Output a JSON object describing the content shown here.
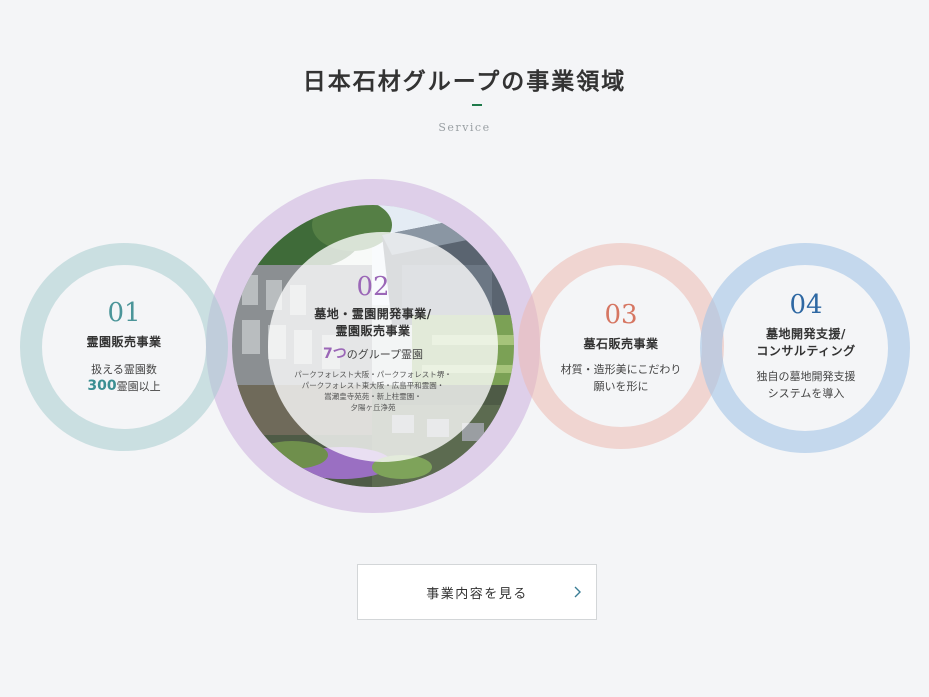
{
  "header": {
    "title": "日本石材グループの事業領域",
    "subtitle": "Service"
  },
  "services": [
    {
      "num": "01",
      "heading_lines": [
        "霊園販売事業"
      ],
      "desc_lines": [
        "扱える霊園数"
      ],
      "highlight_value": "300",
      "highlight_suffix": "霊園以上",
      "color": "#4b9599"
    },
    {
      "num": "02",
      "heading_lines": [
        "墓地・霊園開発事業/",
        "霊園販売事業"
      ],
      "highlight_value": "7つ",
      "highlight_suffix": "のグループ霊園",
      "small_lines": [
        "パークフォレスト大阪・パークフォレスト堺・",
        "パークフォレスト東大阪・広島平和霊園・",
        "嵩瀬皇寺苑苑・新上柱霊園・",
        "夕陽ヶ丘浄苑"
      ],
      "color": "#9b67b7"
    },
    {
      "num": "03",
      "heading_lines": [
        "墓石販売事業"
      ],
      "desc_lines": [
        "材質・造形美にこだわり",
        "願いを形に"
      ],
      "color": "#d67662"
    },
    {
      "num": "04",
      "heading_lines": [
        "墓地開発支援/",
        "コンサルティング"
      ],
      "desc_lines": [
        "独自の墓地開発支援",
        "システムを導入"
      ],
      "color": "#2e68a3"
    }
  ],
  "cta": {
    "label": "事業内容を見る",
    "icon": "chevron-right-icon"
  }
}
